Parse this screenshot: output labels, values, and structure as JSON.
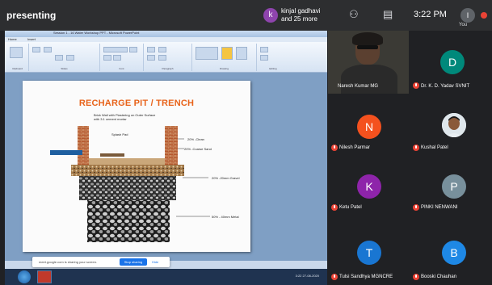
{
  "topbar": {
    "status": "presenting",
    "presenter_initial": "k",
    "presenter_name_line1": "kinjal gadhavi",
    "presenter_name_line2": "and 25 more",
    "clock": "3:22 PM",
    "you_label": "You",
    "you_initial": "I"
  },
  "presentation": {
    "title_bar": "Session 1 - 16 Water Workshop PPT - Microsoft PowerPoint",
    "tabs": [
      "Home",
      "Insert"
    ],
    "ribbon_groups": [
      "Clipboard",
      "Slides",
      "Font",
      "Paragraph",
      "Drawing",
      "Editing"
    ],
    "slide": {
      "title": "RECHARGE PIT / TRENCH",
      "annotations": {
        "brick": "Brick Wall with Plastering on Outer Surface with 3:1 cement mortar",
        "splash": "Splash Pad",
        "clean": "20% -Clean",
        "coarse": "20% -Coarse Sand",
        "gravel": "20% -20mm Gravel",
        "metal": "50% - 40mm Metal"
      }
    },
    "share_bar": {
      "message": "meet.google.com is sharing your screen.",
      "stop": "Stop sharing",
      "hide": "Hide"
    },
    "tray_time": "3:22",
    "tray_date": "27-08-2020"
  },
  "participants": [
    {
      "name": "Naresh Kumar MG",
      "initial": "",
      "color": "#3b3a35"
    },
    {
      "name": "Dr. K. D. Yadav SVNIT",
      "initial": "D",
      "color": "#00897b"
    },
    {
      "name": "Nilesh Parmar",
      "initial": "N",
      "color": "#f4511e"
    },
    {
      "name": "Kushal Patel",
      "initial": "",
      "color": "#dfe7ec"
    },
    {
      "name": "Ketu Patel",
      "initial": "K",
      "color": "#8e24aa"
    },
    {
      "name": "PINKI NENWANI",
      "initial": "P",
      "color": "#78909c"
    },
    {
      "name": "Tulsi Sandhya MGNCRE",
      "initial": "T",
      "color": "#1976d2"
    },
    {
      "name": "Booski Chauhan",
      "initial": "B",
      "color": "#1e88e5"
    }
  ]
}
